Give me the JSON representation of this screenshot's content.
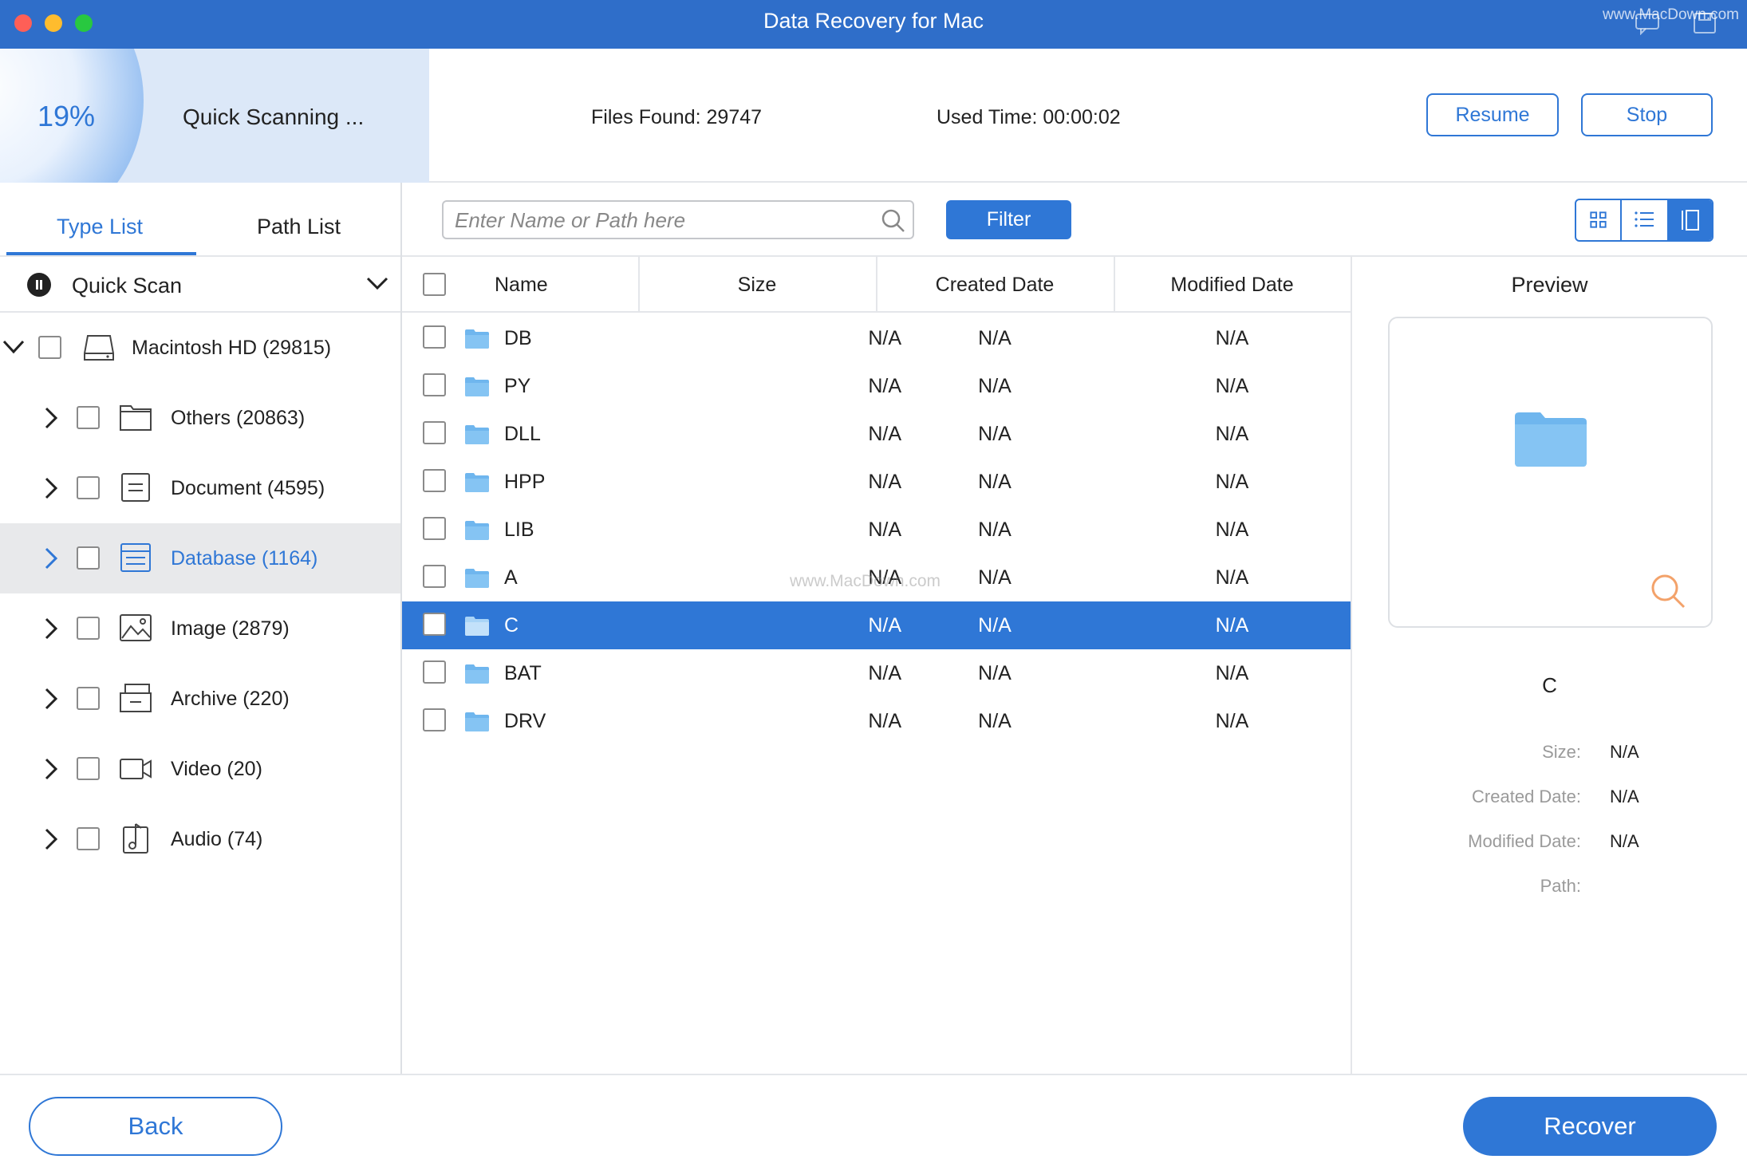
{
  "window": {
    "title": "Data Recovery for Mac",
    "watermark": "www.MacDown.com"
  },
  "scan": {
    "progress_text": "19%",
    "progress": 0.19,
    "status_label": "Quick Scanning ...",
    "files_found": "Files Found: 29747",
    "used_time": "Used Time: 00:00:02",
    "resume_label": "Resume",
    "stop_label": "Stop"
  },
  "sidebar": {
    "tabs": [
      {
        "label": "Type List",
        "active": true
      },
      {
        "label": "Path List",
        "active": false
      }
    ],
    "scan_mode": "Quick Scan",
    "root": {
      "label": "Macintosh HD (29815)",
      "icon": "drive-icon",
      "expanded": true
    },
    "items": [
      {
        "label": "Others (20863)",
        "icon": "folder-outline-icon"
      },
      {
        "label": "Document (4595)",
        "icon": "document-icon"
      },
      {
        "label": "Database (1164)",
        "icon": "database-icon",
        "selected": true
      },
      {
        "label": "Image (2879)",
        "icon": "image-icon"
      },
      {
        "label": "Archive (220)",
        "icon": "archive-icon"
      },
      {
        "label": "Video (20)",
        "icon": "video-icon"
      },
      {
        "label": "Audio (74)",
        "icon": "audio-icon"
      }
    ]
  },
  "toolbar": {
    "search_placeholder": "Enter Name or Path here",
    "filter_label": "Filter",
    "views": [
      "grid-view-icon",
      "list-view-icon",
      "preview-view-icon"
    ],
    "active_view": "preview-view-icon"
  },
  "table": {
    "columns": [
      "Name",
      "Size",
      "Created Date",
      "Modified Date"
    ],
    "rows": [
      {
        "name": "DB",
        "size": "N/A",
        "created": "N/A",
        "modified": "N/A"
      },
      {
        "name": "PY",
        "size": "N/A",
        "created": "N/A",
        "modified": "N/A"
      },
      {
        "name": "DLL",
        "size": "N/A",
        "created": "N/A",
        "modified": "N/A"
      },
      {
        "name": "HPP",
        "size": "N/A",
        "created": "N/A",
        "modified": "N/A"
      },
      {
        "name": "LIB",
        "size": "N/A",
        "created": "N/A",
        "modified": "N/A"
      },
      {
        "name": "A",
        "size": "N/A",
        "created": "N/A",
        "modified": "N/A"
      },
      {
        "name": "C",
        "size": "N/A",
        "created": "N/A",
        "modified": "N/A",
        "selected": true
      },
      {
        "name": "BAT",
        "size": "N/A",
        "created": "N/A",
        "modified": "N/A"
      },
      {
        "name": "DRV",
        "size": "N/A",
        "created": "N/A",
        "modified": "N/A"
      }
    ],
    "watermark": "www.MacDown.com"
  },
  "preview": {
    "title": "Preview",
    "name": "C",
    "fields": [
      {
        "label": "Size:",
        "value": "N/A"
      },
      {
        "label": "Created Date:",
        "value": "N/A"
      },
      {
        "label": "Modified Date:",
        "value": "N/A"
      },
      {
        "label": "Path:",
        "value": ""
      }
    ]
  },
  "footer": {
    "back_label": "Back",
    "recover_label": "Recover"
  },
  "colors": {
    "accent": "#2f77d6",
    "titlebar": "#2f6ec9",
    "selected_row": "#2f77d6",
    "sidebar_selected": "#e8e9eb"
  }
}
